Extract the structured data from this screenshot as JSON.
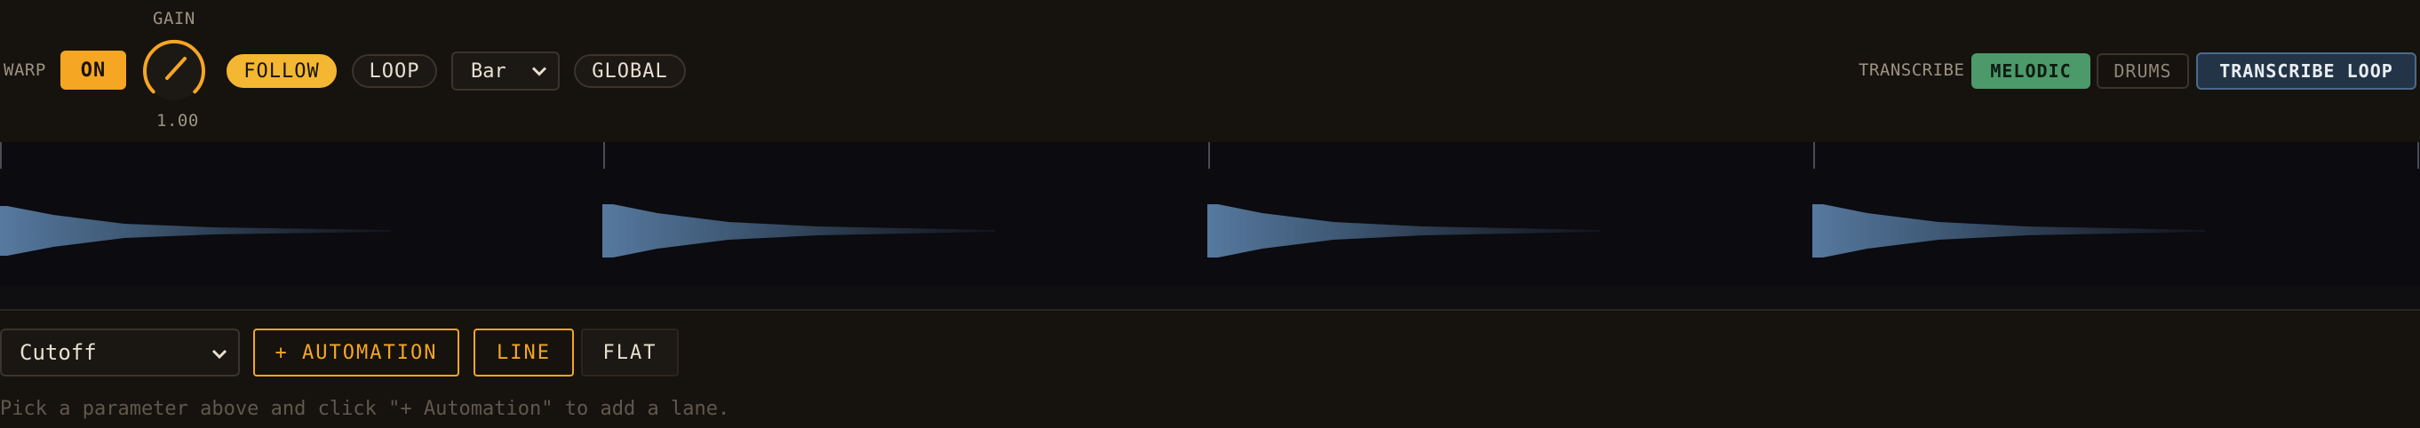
{
  "toolbar": {
    "warp_label": "WARP",
    "warp_on": "ON",
    "gain_label": "GAIN",
    "gain_value": "1.00",
    "gain_level": 0.5,
    "follow": "FOLLOW",
    "loop": "LOOP",
    "grid_select": "Bar",
    "global": "GLOBAL",
    "transcribe_label": "TRANSCRIBE",
    "melodic": "MELODIC",
    "drums": "DRUMS",
    "transcribe_loop": "TRANSCRIBE LOOP"
  },
  "automation": {
    "parameter_select": "Cutoff",
    "add_automation": "+ AUTOMATION",
    "line": "LINE",
    "flat": "FLAT",
    "hint": "Pick a parameter above and click \"+ Automation\" to add a lane."
  },
  "colors": {
    "accent_orange": "#f5a623",
    "follow_yellow": "#f4b731",
    "melodic_green": "#4c9a6a",
    "transcribe_loop_blue": "#243447",
    "waveform": "#4a6a8c",
    "background": "#16120d"
  },
  "icons": {
    "gain_knob": "knob-icon",
    "select_chevron": "chevron-down-icon"
  }
}
